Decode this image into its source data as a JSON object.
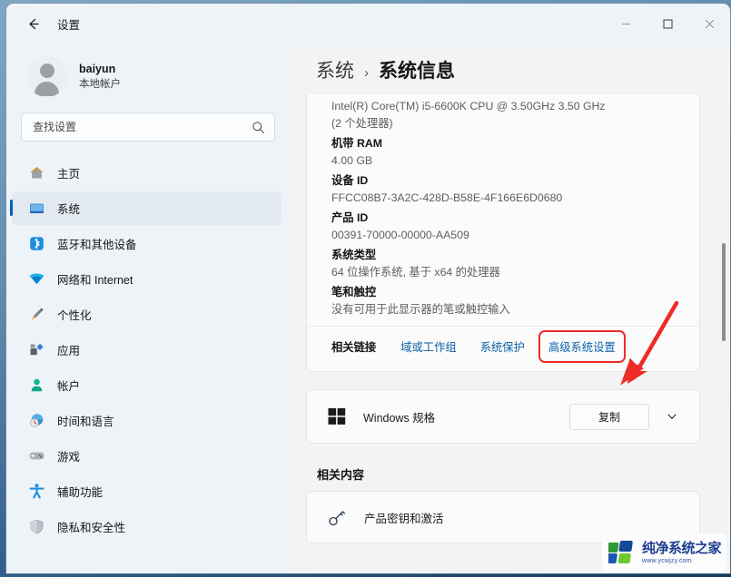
{
  "window": {
    "title": "设置",
    "back_icon": "back-arrow-icon",
    "minimize_label": "—",
    "maximize_label": "☐",
    "close_label": "✕"
  },
  "sidebar": {
    "account": {
      "name": "baiyun",
      "type": "本地帐户",
      "avatar_icon": "avatar-icon"
    },
    "search": {
      "placeholder": "查找设置",
      "value": "",
      "icon": "search-icon"
    },
    "items": [
      {
        "label": "主页",
        "icon": "home-icon",
        "selected": false
      },
      {
        "label": "系统",
        "icon": "system-icon",
        "selected": true
      },
      {
        "label": "蓝牙和其他设备",
        "icon": "bluetooth-icon",
        "selected": false
      },
      {
        "label": "网络和 Internet",
        "icon": "network-icon",
        "selected": false
      },
      {
        "label": "个性化",
        "icon": "personalization-icon",
        "selected": false
      },
      {
        "label": "应用",
        "icon": "apps-icon",
        "selected": false
      },
      {
        "label": "帐户",
        "icon": "accounts-icon",
        "selected": false
      },
      {
        "label": "时间和语言",
        "icon": "time-language-icon",
        "selected": false
      },
      {
        "label": "游戏",
        "icon": "gaming-icon",
        "selected": false
      },
      {
        "label": "辅助功能",
        "icon": "accessibility-icon",
        "selected": false
      },
      {
        "label": "隐私和安全性",
        "icon": "privacy-security-icon",
        "selected": false
      }
    ]
  },
  "breadcrumb": {
    "parent": "系统",
    "separator": "›",
    "current": "系统信息"
  },
  "device_specs": [
    {
      "type": "value",
      "text": "Intel(R) Core(TM) i5-6600K CPU @ 3.50GHz   3.50 GHz"
    },
    {
      "type": "value",
      "text": "(2 个处理器)"
    },
    {
      "type": "key",
      "text": "机带 RAM"
    },
    {
      "type": "value",
      "text": "4.00 GB"
    },
    {
      "type": "key",
      "text": "设备 ID"
    },
    {
      "type": "value",
      "text": "FFCC08B7-3A2C-428D-B58E-4F166E6D0680"
    },
    {
      "type": "key",
      "text": "产品 ID"
    },
    {
      "type": "value",
      "text": "00391-70000-00000-AA509"
    },
    {
      "type": "key",
      "text": "系统类型"
    },
    {
      "type": "value",
      "text": "64 位操作系统, 基于 x64 的处理器"
    },
    {
      "type": "key",
      "text": "笔和触控"
    },
    {
      "type": "value",
      "text": "没有可用于此显示器的笔或触控输入"
    }
  ],
  "related_links": {
    "label": "相关链接",
    "links": [
      {
        "text": "域或工作组",
        "highlighted": false
      },
      {
        "text": "系统保护",
        "highlighted": false
      },
      {
        "text": "高级系统设置",
        "highlighted": true
      }
    ]
  },
  "windows_spec": {
    "label": "Windows 规格",
    "icon": "windows-logo-icon",
    "copy_label": "复制",
    "expand_icon": "chevron-down-icon"
  },
  "related_content": {
    "heading": "相关内容",
    "items": [
      {
        "label": "产品密钥和激活",
        "icon": "key-icon"
      }
    ]
  },
  "annotation": {
    "arrow_color": "#ee2b26",
    "highlight_color": "#ee2b26"
  },
  "watermark": {
    "title": "纯净系统之家",
    "url": "www.ycwjzy.com",
    "icon": "watermark-logo-icon"
  }
}
